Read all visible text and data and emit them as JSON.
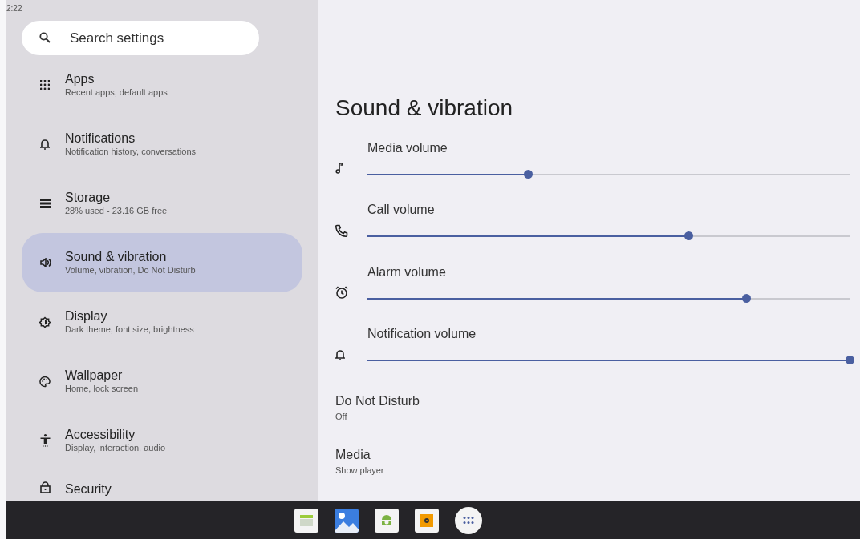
{
  "status_bar": {
    "time": "2:22"
  },
  "search": {
    "placeholder": "Search settings"
  },
  "sidebar": {
    "items": [
      {
        "kind": "apps",
        "title": "Apps",
        "subtitle": "Recent apps, default apps",
        "selected": false
      },
      {
        "kind": "bell",
        "title": "Notifications",
        "subtitle": "Notification history, conversations",
        "selected": false
      },
      {
        "kind": "storage",
        "title": "Storage",
        "subtitle": "28% used - 23.16 GB free",
        "selected": false
      },
      {
        "kind": "speaker",
        "title": "Sound & vibration",
        "subtitle": "Volume, vibration, Do Not Disturb",
        "selected": true
      },
      {
        "kind": "display",
        "title": "Display",
        "subtitle": "Dark theme, font size, brightness",
        "selected": false
      },
      {
        "kind": "palette",
        "title": "Wallpaper",
        "subtitle": "Home, lock screen",
        "selected": false
      },
      {
        "kind": "accessibility",
        "title": "Accessibility",
        "subtitle": "Display, interaction, audio",
        "selected": false
      },
      {
        "kind": "lock",
        "title": "Security",
        "selected": false
      }
    ]
  },
  "page": {
    "title": "Sound & vibration",
    "volumes": [
      {
        "kind": "note",
        "label": "Media volume",
        "level": 0.333
      },
      {
        "kind": "phone",
        "label": "Call volume",
        "level": 0.667
      },
      {
        "kind": "alarm",
        "label": "Alarm volume",
        "level": 0.787
      },
      {
        "kind": "bell",
        "label": "Notification volume",
        "level": 1.0
      }
    ],
    "settings": [
      {
        "title": "Do Not Disturb",
        "subtitle": "Off"
      },
      {
        "title": "Media",
        "subtitle": "Show player"
      }
    ]
  },
  "taskbar": {
    "apps": [
      {
        "kind": "spreadsheet"
      },
      {
        "kind": "gallery"
      },
      {
        "kind": "android"
      },
      {
        "kind": "music"
      },
      {
        "kind": "launcher"
      }
    ]
  }
}
